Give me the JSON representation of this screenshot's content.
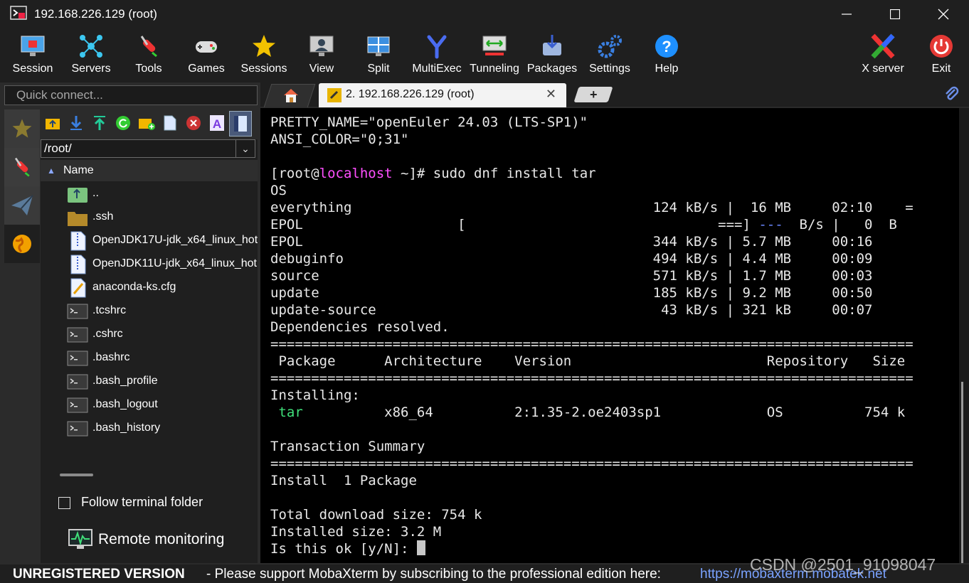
{
  "window": {
    "title": "192.168.226.129 (root)"
  },
  "toolbar": {
    "items": [
      {
        "label": "Session",
        "icon": "monitor-session-icon"
      },
      {
        "label": "Servers",
        "icon": "servers-network-icon"
      },
      {
        "label": "Tools",
        "icon": "swiss-knife-icon"
      },
      {
        "label": "Games",
        "icon": "gamepad-icon"
      },
      {
        "label": "Sessions",
        "icon": "star-icon"
      },
      {
        "label": "View",
        "icon": "view-monitor-icon"
      },
      {
        "label": "Split",
        "icon": "split-icon"
      },
      {
        "label": "MultiExec",
        "icon": "multiexec-fork-icon"
      },
      {
        "label": "Tunneling",
        "icon": "tunneling-icon"
      },
      {
        "label": "Packages",
        "icon": "packages-icon"
      },
      {
        "label": "Settings",
        "icon": "gears-icon"
      },
      {
        "label": "Help",
        "icon": "help-icon"
      }
    ],
    "xserver_label": "X server",
    "exit_label": "Exit"
  },
  "quick_connect": {
    "placeholder": "Quick connect..."
  },
  "tabs": {
    "active_label": "2. 192.168.226.129 (root)"
  },
  "sftp": {
    "path": "/root/",
    "column_name": "Name",
    "files": [
      {
        "name": "..",
        "type": "parent-folder"
      },
      {
        "name": ".ssh",
        "type": "folder"
      },
      {
        "name": "OpenJDK17U-jdk_x64_linux_hot",
        "type": "archive"
      },
      {
        "name": "OpenJDK11U-jdk_x64_linux_hot",
        "type": "archive"
      },
      {
        "name": "anaconda-ks.cfg",
        "type": "config"
      },
      {
        "name": ".tcshrc",
        "type": "script"
      },
      {
        "name": ".cshrc",
        "type": "script"
      },
      {
        "name": ".bashrc",
        "type": "script"
      },
      {
        "name": ".bash_profile",
        "type": "script"
      },
      {
        "name": ".bash_logout",
        "type": "script"
      },
      {
        "name": ".bash_history",
        "type": "script"
      }
    ],
    "follow_terminal_folder": "Follow terminal folder",
    "remote_monitoring": "Remote monitoring"
  },
  "terminal": {
    "l1": "PRETTY_NAME=\"openEuler 24.03 (LTS-SP1)\"",
    "l2": "ANSI_COLOR=\"0;31\"",
    "prompt_open": "[root@",
    "prompt_host": "localhost",
    "prompt_rest": " ~]# sudo dnf install tar",
    "l_os": "OS",
    "l_everything": "everything                                     124 kB/s |  16 MB     02:10    =",
    "l_epol_a": "EPOL                   [                               ===] ",
    "l_epol_b": "---",
    "l_epol_c": "  B/s |   0  B",
    "l_epol": "EPOL                                           344 kB/s | 5.7 MB     00:16",
    "l_debuginfo": "debuginfo                                      494 kB/s | 4.4 MB     00:09",
    "l_source": "source                                         571 kB/s | 1.7 MB     00:03",
    "l_update": "update                                         185 kB/s | 9.2 MB     00:50",
    "l_update_source": "update-source                                   43 kB/s | 321 kB     00:07",
    "l_deps": "Dependencies resolved.",
    "rule": "===============================================================================",
    "l_header": " Package      Architecture    Version                        Repository   Size",
    "l_installing": "Installing:",
    "pkg_name": " tar",
    "pkg_rest": "          x86_64          2:1.35-2.oe2403sp1             OS          754 k",
    "l_summary": "Transaction Summary",
    "l_install": "Install  1 Package",
    "l_total": "Total download size: 754 k",
    "l_installed": "Installed size: 3.2 M",
    "l_prompt_yn": "Is this ok [y/N]: "
  },
  "status": {
    "unregistered": "UNREGISTERED VERSION",
    "message": "-  Please support MobaXterm by subscribing to the professional edition here:",
    "link": "https://mobaxterm.mobatek.net"
  },
  "watermark": "CSDN @2501_91098047",
  "colors": {
    "prompt_host": "#ff4fff",
    "package_name": "#3fe07a",
    "dashes": "#6a86ff",
    "link": "#7aa2ff"
  }
}
